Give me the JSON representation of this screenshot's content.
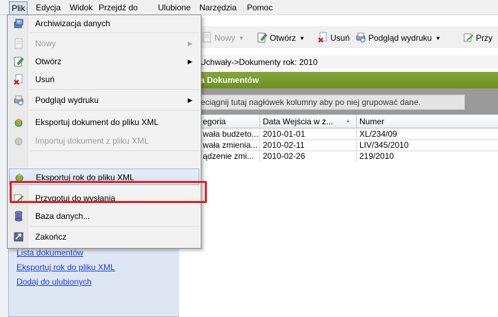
{
  "menubar": {
    "items": [
      "Plik",
      "Edycja",
      "Widok",
      "Przejdź do",
      "Ulubione",
      "Narzędzia",
      "Pomoc"
    ]
  },
  "toolbar": {
    "new_label": "Nowy",
    "open_label": "Otwórz",
    "delete_label": "Usuń",
    "preview_label": "Podgląd wydruku",
    "prz_label": "Przy"
  },
  "breadcrumb": "Uchwały->Dokumenty rok: 2010",
  "panel_header": "a Dokumentów",
  "group_hint": "eciągnij tutaj nagłówek kolumny aby po niej grupować dane.",
  "grid": {
    "columns": [
      "egoria",
      "Data Wejścia w ż...",
      "Numer"
    ],
    "rows": [
      [
        "wała budżeto...",
        "2010-01-01",
        "XL/234/09"
      ],
      [
        "wała zmienia...",
        "2010-02-11",
        "LIV/345/2010"
      ],
      [
        "ądzenie zmi...",
        "2010-02-26",
        "219/2010"
      ]
    ]
  },
  "file_menu": {
    "items": [
      {
        "label": "Archiwizacja danych",
        "icon": "archive-icon",
        "disabled": false,
        "submenu": false
      },
      {
        "label": "Nowy",
        "icon": "new-doc-icon",
        "disabled": true,
        "submenu": true
      },
      {
        "label": "Otwórz",
        "icon": "edit-doc-icon",
        "disabled": false,
        "submenu": true
      },
      {
        "label": "Usuń",
        "icon": "delete-icon",
        "disabled": false,
        "submenu": false
      },
      {
        "label": "Podgląd wydruku",
        "icon": "print-preview-icon",
        "disabled": false,
        "submenu": true
      },
      {
        "label": "Eksportuj dokument do pliku XML",
        "icon": "export-xml-icon",
        "disabled": false,
        "submenu": false
      },
      {
        "label": "Importuj dokument z pliku XML",
        "icon": "import-xml-icon",
        "disabled": true,
        "submenu": false
      },
      {
        "label": "Eksportuj rok do pliku XML",
        "icon": "export-year-icon",
        "disabled": false,
        "submenu": false
      },
      {
        "label": "Przygotuj do wysłania",
        "icon": "prepare-send-icon",
        "disabled": false,
        "submenu": false
      },
      {
        "label": "Baza danych...",
        "icon": "database-icon",
        "disabled": false,
        "submenu": false
      },
      {
        "label": "Zakończ",
        "icon": "exit-icon",
        "disabled": false,
        "submenu": false
      }
    ]
  },
  "left_links": [
    "Lista dokumentów",
    "Eksportuj rok do pliku XML",
    "Dodaj do ulubionych"
  ],
  "colors": {
    "highlight_box": "#e3211b",
    "header_green": "#7a9a2e",
    "link": "#1b3fd6"
  }
}
